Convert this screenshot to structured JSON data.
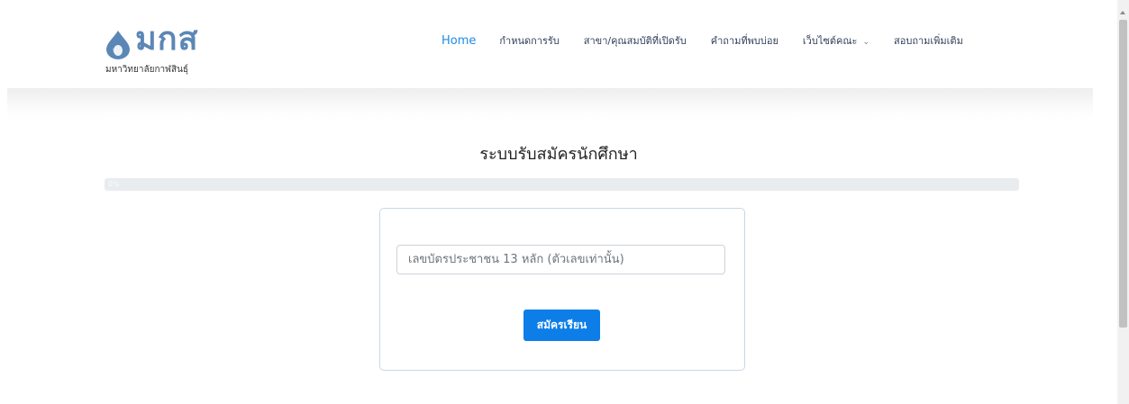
{
  "brand": {
    "logo_text": "มกส",
    "subtitle": "มหาวิทยาลัยกาฬสินธุ์",
    "color": "#5b87b6",
    "icon": "water-drop-icon"
  },
  "nav": {
    "items": [
      {
        "label": "Home",
        "active": true
      },
      {
        "label": "กำหนดการรับ"
      },
      {
        "label": "สาขา/คุณสมบัติที่เปิดรับ"
      },
      {
        "label": "คำถามที่พบบ่อย"
      },
      {
        "label": "เว็บไซต์คณะ",
        "dropdown": true
      },
      {
        "label": "สอบถามเพิ่มเติม"
      }
    ],
    "active_color": "#1e8be6",
    "caret": "⌄"
  },
  "page": {
    "title": "ระบบรับสมัครนักศึกษา"
  },
  "progress": {
    "label": "0%",
    "value": 0
  },
  "form": {
    "id_placeholder": "เลขบัตรประชาชน 13 หลัก (ตัวเลขเท่านั้น)",
    "id_value": "",
    "submit_label": "สมัครเรียน",
    "button_color": "#0d7ee7"
  }
}
